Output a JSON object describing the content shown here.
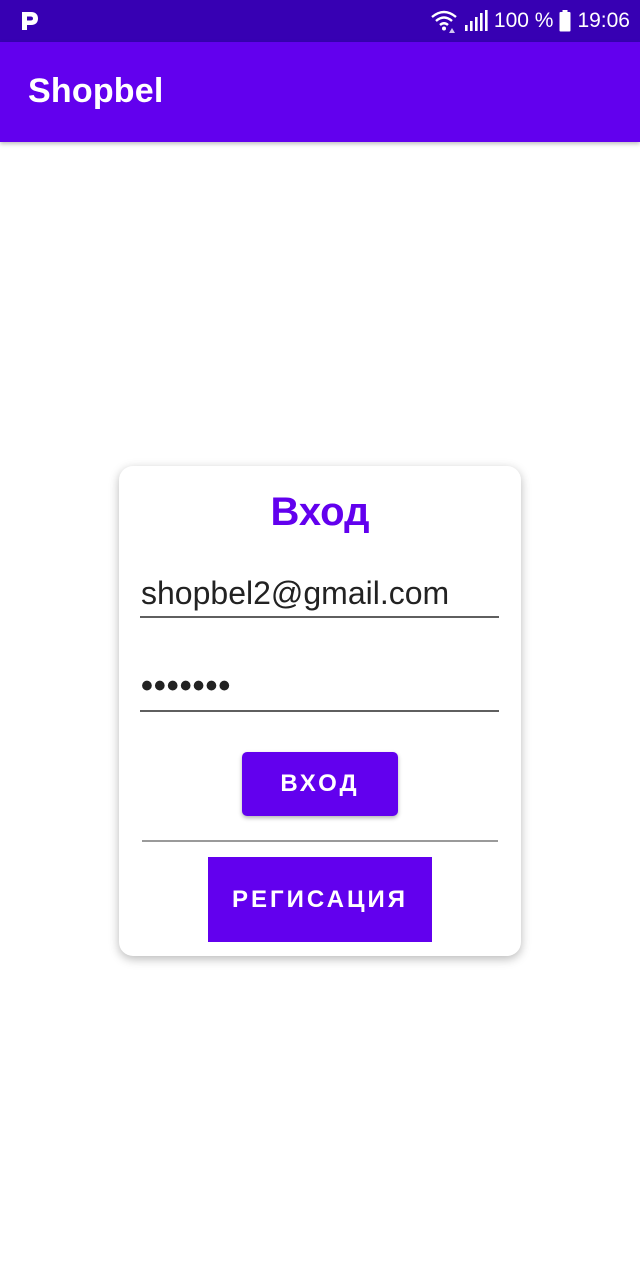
{
  "status_bar": {
    "notification_icon": "p-app-icon",
    "wifi_icon": "wifi-icon",
    "signal_icon": "signal-icon",
    "battery_text": "100 %",
    "battery_icon": "battery-icon",
    "time": "19:06"
  },
  "app_bar": {
    "title": "Shopbel"
  },
  "login_card": {
    "title": "Вход",
    "email_value": "shopbel2@gmail.com",
    "password_value": "•••••••",
    "login_button_label": "ВХОД",
    "register_button_label": "РЕГИСАЦИЯ"
  },
  "colors": {
    "status_bar": "#3700B3",
    "app_bar": "#6200EE",
    "accent": "#6200EE",
    "background": "#FFFFFF"
  }
}
